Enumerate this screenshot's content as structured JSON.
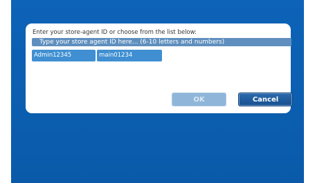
{
  "dialog": {
    "prompt": "Enter your store-agent ID or choose from the list below:",
    "input": {
      "placeholder": "Type your store agent ID here... (6-10 letters and numbers)",
      "value": ""
    },
    "agents": [
      "Admin12345",
      "main01234"
    ],
    "ok_label": "OK",
    "cancel_label": "Cancel"
  },
  "colors": {
    "background": "#0d63b8",
    "input_fill": "#5f8fbe",
    "chip_fill": "#3f8fd2",
    "ok_disabled": "#8fb6d9",
    "cancel_fill": "#1f5c9e"
  }
}
